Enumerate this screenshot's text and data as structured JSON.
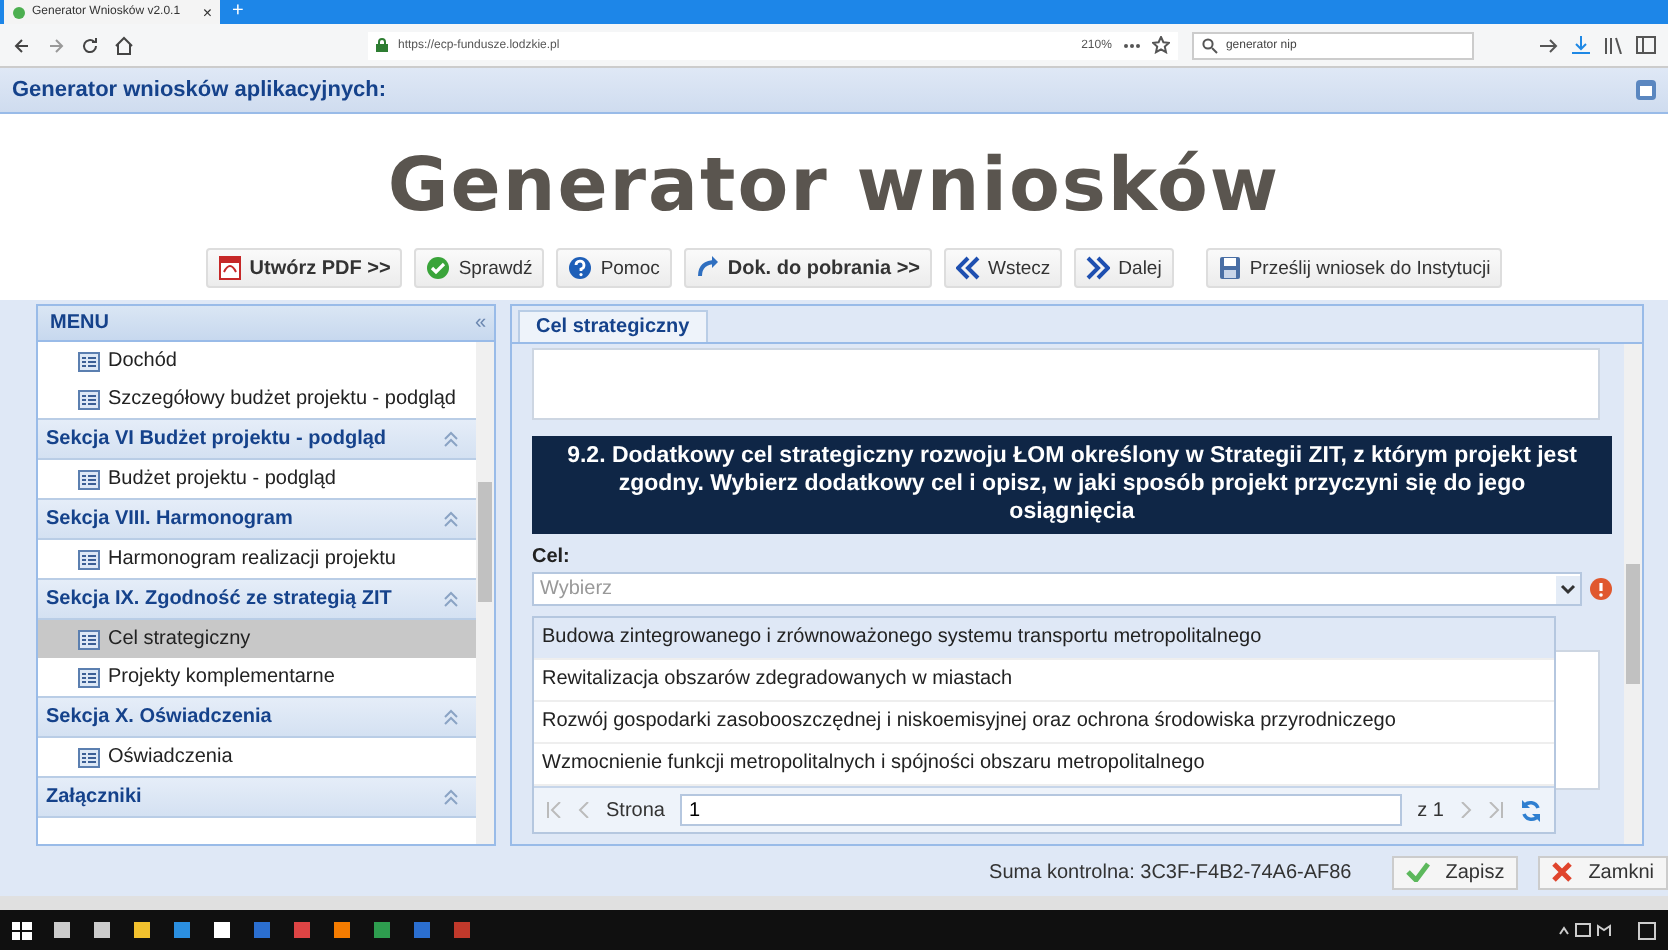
{
  "browser": {
    "tab_title": "Generator Wniosków v2.0.1",
    "url": "https://ecp-fundusze.lodzkie.pl",
    "zoom": "210%",
    "search": "generator nip",
    "tab_close": "×",
    "new_tab": "+"
  },
  "app": {
    "header": "Generator wniosków aplikacyjnych:",
    "title": "Generator wniosków"
  },
  "toolbar": [
    {
      "label": "Utwórz PDF >>",
      "kind": "pdf",
      "bold": true
    },
    {
      "label": "Sprawdź",
      "kind": "check",
      "bold": false
    },
    {
      "label": "Pomoc",
      "kind": "help",
      "bold": false
    },
    {
      "label": "Dok. do pobrania >>",
      "kind": "download",
      "bold": true
    },
    {
      "label": "Wstecz",
      "kind": "back",
      "bold": false
    },
    {
      "label": "Dalej",
      "kind": "next",
      "bold": false
    },
    {
      "label": "Prześlij wniosek do Instytucji",
      "kind": "send",
      "bold": false
    }
  ],
  "menu": {
    "title": "MENU",
    "collapse": "«",
    "sections": [
      {
        "items": [
          {
            "label": "Dochód",
            "selected": false
          },
          {
            "label": "Szczegółowy budżet projektu - podgląd",
            "selected": false
          }
        ]
      },
      {
        "title": "Sekcja VI Budżet projektu - podgląd",
        "expanded": true,
        "items": [
          {
            "label": "Budżet projektu - podgląd",
            "selected": false
          }
        ]
      },
      {
        "title": "Sekcja VIII. Harmonogram",
        "expanded": true,
        "items": [
          {
            "label": "Harmonogram realizacji projektu",
            "selected": false
          }
        ]
      },
      {
        "title": "Sekcja IX. Zgodność ze strategią ZIT",
        "expanded": true,
        "items": [
          {
            "label": "Cel strategiczny",
            "selected": true
          },
          {
            "label": "Projekty komplementarne",
            "selected": false
          }
        ]
      },
      {
        "title": "Sekcja X. Oświadczenia",
        "expanded": true,
        "items": [
          {
            "label": "Oświadczenia",
            "selected": false
          }
        ]
      },
      {
        "title": "Załączniki",
        "expanded": true
      }
    ]
  },
  "tabs": [
    {
      "label": "Cel strategiczny",
      "selected": true
    }
  ],
  "question": "9.2. Dodatkowy cel strategiczny rozwoju ŁOM określony w Strategii ZIT, z którym projekt jest zgodny. Wybierz dodatkowy cel i opisz, w jaki sposób projekt przyczyni się do jego osiągnięcia",
  "field": {
    "label": "Cel:",
    "placeholder": "Wybierz",
    "error": true,
    "options": [
      {
        "label": "Budowa zintegrowanego i zrównoważonego systemu transportu metropolitalnego",
        "selected": true
      },
      {
        "label": "Rewitalizacja obszarów zdegradowanych w miastach",
        "selected": false
      },
      {
        "label": "Rozwój gospodarki zasobooszczędnej i niskoemisyjnej oraz ochrona środowiska przyrodniczego",
        "selected": false
      },
      {
        "label": "Wzmocnienie funkcji metropolitalnych i spójności obszaru metropolitalnego",
        "selected": false
      }
    ],
    "pager": {
      "page_label": "Strona",
      "page": "1",
      "of": "z 1"
    }
  },
  "status": {
    "checksum": "Suma kontrolna: 3C3F-F4B2-74A6-AF86",
    "buttons": [
      {
        "label": "Zapisz",
        "kind": "save"
      },
      {
        "label": "Zamkni",
        "kind": "close"
      }
    ]
  }
}
